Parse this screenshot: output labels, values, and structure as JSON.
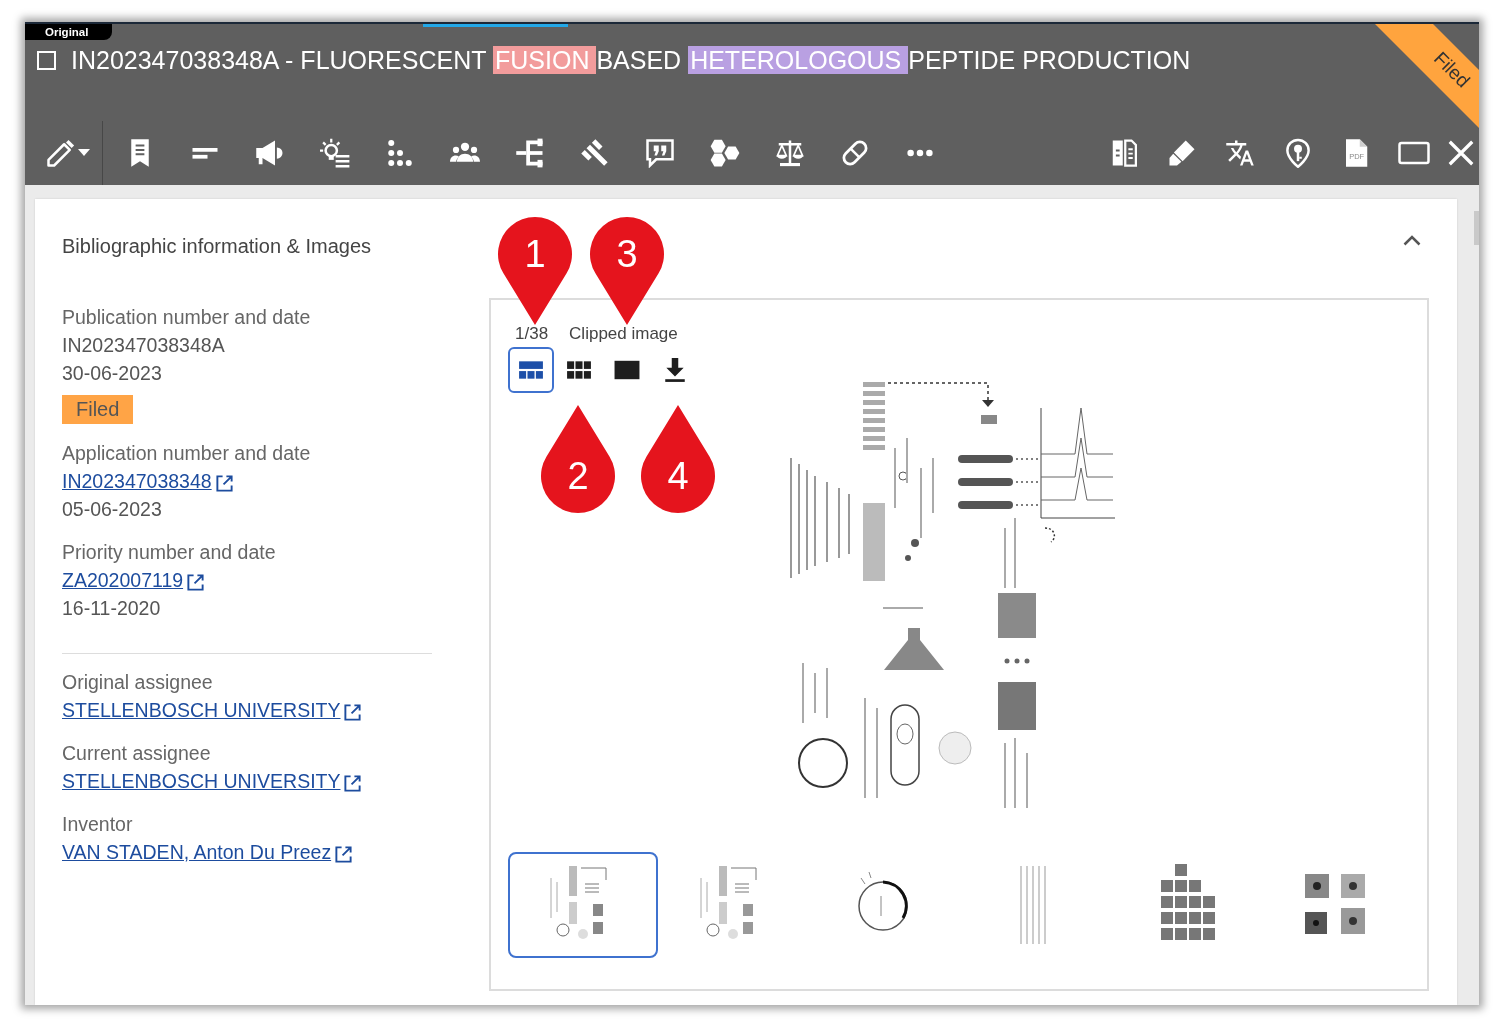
{
  "source_label": "Original",
  "title": {
    "checked": false,
    "segments": [
      {
        "text": "IN202347038348A - FLUORESCENT"
      },
      {
        "text": "FUSION",
        "color": "#f29c9c"
      },
      {
        "text": "BASED"
      },
      {
        "text": "HETEROLOGOUS",
        "color": "#b9a0e2"
      },
      {
        "text": "PEPTIDE PRODUCTION"
      }
    ]
  },
  "status_ribbon": "Filed",
  "toolbar": {
    "pdf_label": "PDF"
  },
  "section": {
    "title": "Bibliographic information & Images",
    "expanded": true
  },
  "field_groups": [
    {
      "fields": [
        {
          "label": "Publication number and date",
          "values": [
            {
              "kind": "text",
              "text": "IN202347038348A"
            },
            {
              "kind": "text",
              "text": "30-06-2023"
            },
            {
              "kind": "badge",
              "text": "Filed"
            }
          ]
        },
        {
          "label": "Application number and date",
          "values": [
            {
              "kind": "link",
              "text": "IN202347038348"
            },
            {
              "kind": "text",
              "text": "05-06-2023"
            }
          ]
        },
        {
          "label": "Priority number and date",
          "values": [
            {
              "kind": "link",
              "text": "ZA202007119"
            },
            {
              "kind": "text",
              "text": "16-11-2020"
            }
          ]
        }
      ]
    },
    {
      "fields": [
        {
          "label": "Original assignee",
          "values": [
            {
              "kind": "link",
              "text": "STELLENBOSCH UNIVERSITY"
            }
          ]
        },
        {
          "label": "Current assignee",
          "values": [
            {
              "kind": "link",
              "text": "STELLENBOSCH UNIVERSITY"
            }
          ]
        },
        {
          "label": "Inventor",
          "values": [
            {
              "kind": "link",
              "text": "VAN STADEN, Anton Du Preez"
            }
          ]
        }
      ]
    }
  ],
  "images": {
    "counter": "1/38",
    "caption": "Clipped image",
    "view_modes": [
      {
        "kind": "gallery",
        "selected": true
      },
      {
        "kind": "grid",
        "selected": false
      },
      {
        "kind": "single",
        "selected": false
      }
    ],
    "thumbnails": [
      {
        "selected": true
      },
      {
        "selected": false
      },
      {
        "selected": false
      },
      {
        "selected": false
      },
      {
        "selected": false
      },
      {
        "selected": false
      }
    ]
  },
  "markers": [
    {
      "label": "1"
    },
    {
      "label": "3"
    },
    {
      "label": "2"
    },
    {
      "label": "4"
    }
  ]
}
